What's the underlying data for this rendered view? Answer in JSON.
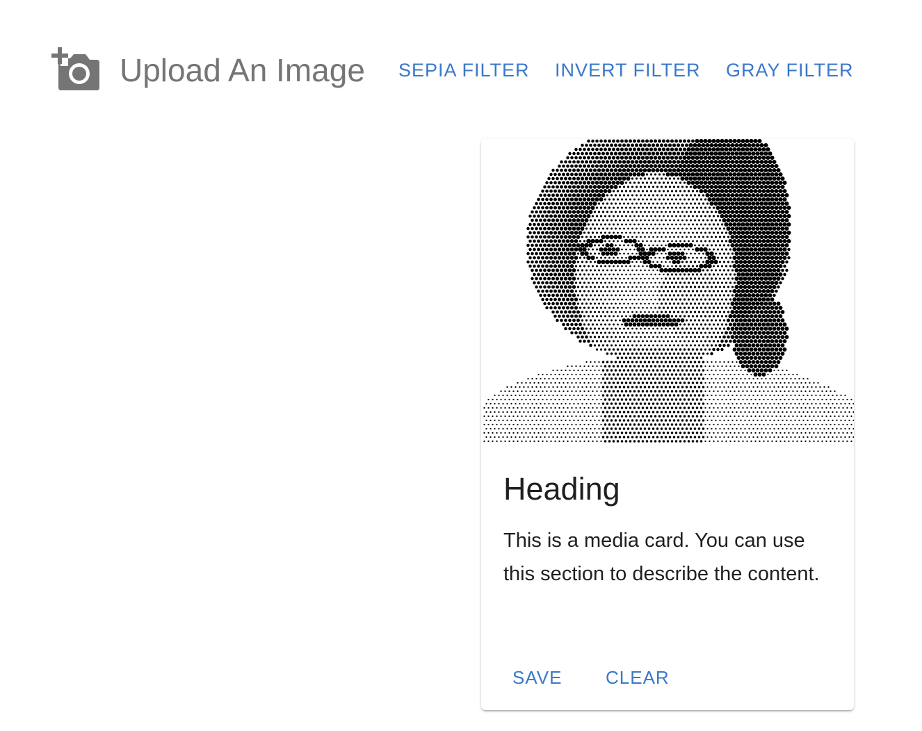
{
  "toolbar": {
    "upload_label": "Upload An Image",
    "upload_icon": "add-a-photo-icon",
    "filters": [
      {
        "label": "SEPIA FILTER"
      },
      {
        "label": "INVERT FILTER"
      },
      {
        "label": "GRAY FILTER"
      }
    ]
  },
  "card": {
    "image_alt": "halftone-portrait",
    "heading": "Heading",
    "body": "This is a media card. You can use this section to describe the content.",
    "actions": {
      "save_label": "SAVE",
      "clear_label": "CLEAR"
    }
  },
  "colors": {
    "accent": "#3a78c9",
    "icon_gray": "#757575",
    "text_dark": "#1f1f1f"
  }
}
